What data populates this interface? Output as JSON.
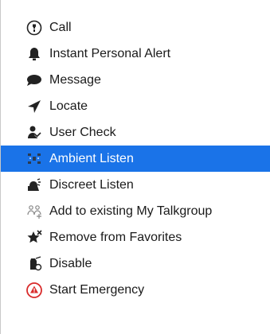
{
  "menu": {
    "items": [
      {
        "label": "Call",
        "icon": "call-icon"
      },
      {
        "label": "Instant Personal Alert",
        "icon": "bell-alert-icon"
      },
      {
        "label": "Message",
        "icon": "message-bubble-icon"
      },
      {
        "label": "Locate",
        "icon": "locate-arrow-icon"
      },
      {
        "label": "User Check",
        "icon": "user-check-icon"
      },
      {
        "label": "Ambient Listen",
        "icon": "ambient-listen-icon",
        "selected": true
      },
      {
        "label": "Discreet Listen",
        "icon": "discreet-listen-icon"
      },
      {
        "label": "Add to existing My Talkgroup",
        "icon": "add-talkgroup-icon"
      },
      {
        "label": "Remove from Favorites",
        "icon": "remove-favorite-star-icon"
      },
      {
        "label": "Disable",
        "icon": "disable-radio-icon"
      },
      {
        "label": "Start Emergency",
        "icon": "emergency-icon"
      }
    ]
  },
  "colors": {
    "selection": "#1a73e8",
    "emergency": "#d92b2b"
  }
}
